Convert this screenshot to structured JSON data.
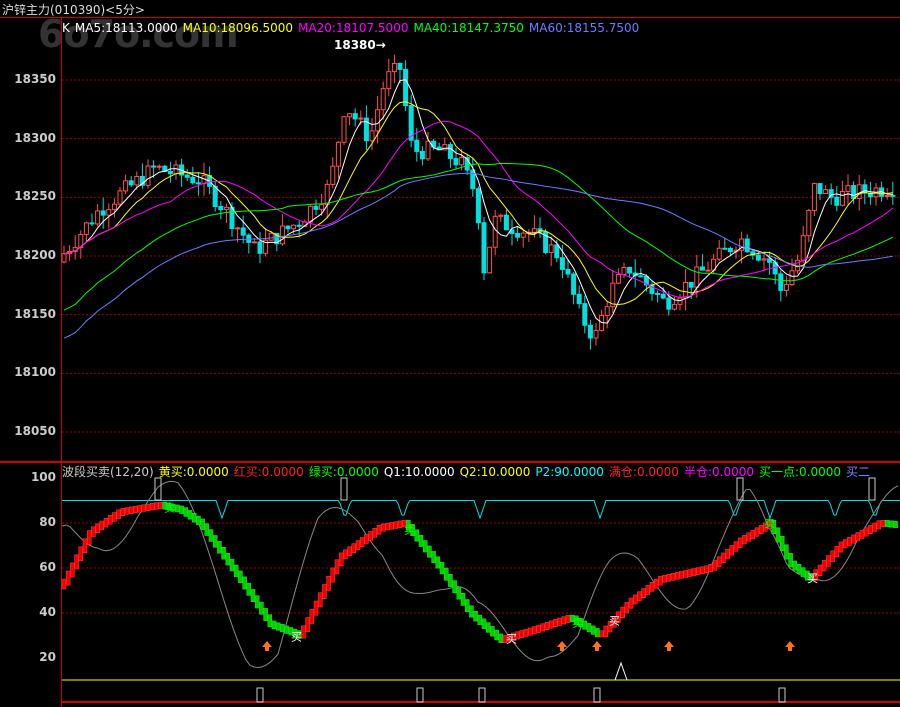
{
  "title": "沪锌主力(010390)<5分>",
  "watermark": "6o7o.com",
  "legend": [
    {
      "text": "K",
      "color": "#ffffff"
    },
    {
      "text": "MA5:18113.0000",
      "color": "#ffffff"
    },
    {
      "text": "MA10:18096.5000",
      "color": "#ffff00"
    },
    {
      "text": "MA20:18107.5000",
      "color": "#ff00ff"
    },
    {
      "text": "MA40:18147.3750",
      "color": "#00ff00"
    },
    {
      "text": "MA60:18155.7500",
      "color": "#6e7cff"
    }
  ],
  "high_marker": "18380→",
  "price_ticks": [
    "18350",
    "18300",
    "18250",
    "18200",
    "18150",
    "18100",
    "18050"
  ],
  "indicator_legend": [
    {
      "text": "波段买卖(12,20)",
      "color": "#cccccc"
    },
    {
      "text": "黄买:0.0000",
      "color": "#ffff00"
    },
    {
      "text": "红买:0.0000",
      "color": "#ff2020"
    },
    {
      "text": "绿买:0.0000",
      "color": "#00ff00"
    },
    {
      "text": "Q1:10.0000",
      "color": "#ffffff"
    },
    {
      "text": "Q2:10.0000",
      "color": "#ffff00"
    },
    {
      "text": "P2:90.0000",
      "color": "#00ffff"
    },
    {
      "text": "满仓:0.0000",
      "color": "#ff2020"
    },
    {
      "text": "半仓:0.0000",
      "color": "#ff00ff"
    },
    {
      "text": "买一点:0.0000",
      "color": "#00ff00"
    },
    {
      "text": "买二",
      "color": "#8080ff"
    }
  ],
  "indicator_ticks": [
    "100",
    "80",
    "60",
    "40",
    "20"
  ],
  "sell_label": "卖",
  "buy_label": "买",
  "price_anchors": [
    [
      62,
      18200
    ],
    [
      100,
      18240
    ],
    [
      155,
      18275
    ],
    [
      200,
      18265
    ],
    [
      220,
      18245
    ],
    [
      255,
      18205
    ],
    [
      300,
      18230
    ],
    [
      330,
      18260
    ],
    [
      345,
      18330
    ],
    [
      370,
      18300
    ],
    [
      385,
      18350
    ],
    [
      400,
      18360
    ],
    [
      412,
      18290
    ],
    [
      440,
      18290
    ],
    [
      460,
      18280
    ],
    [
      478,
      18250
    ],
    [
      480,
      18175
    ],
    [
      495,
      18230
    ],
    [
      530,
      18220
    ],
    [
      560,
      18200
    ],
    [
      580,
      18150
    ],
    [
      595,
      18130
    ],
    [
      610,
      18170
    ],
    [
      630,
      18190
    ],
    [
      665,
      18160
    ],
    [
      700,
      18185
    ],
    [
      740,
      18215
    ],
    [
      770,
      18195
    ],
    [
      780,
      18170
    ],
    [
      800,
      18200
    ],
    [
      815,
      18260
    ],
    [
      830,
      18250
    ],
    [
      900,
      18260
    ]
  ],
  "wave_anchors": [
    [
      62,
      52
    ],
    [
      90,
      76
    ],
    [
      120,
      85
    ],
    [
      160,
      88
    ],
    [
      180,
      86
    ],
    [
      200,
      80
    ],
    [
      240,
      55
    ],
    [
      270,
      35
    ],
    [
      300,
      30
    ],
    [
      340,
      65
    ],
    [
      380,
      78
    ],
    [
      405,
      80
    ],
    [
      440,
      60
    ],
    [
      470,
      40
    ],
    [
      500,
      28
    ],
    [
      530,
      32
    ],
    [
      570,
      38
    ],
    [
      600,
      30
    ],
    [
      630,
      45
    ],
    [
      660,
      55
    ],
    [
      710,
      60
    ],
    [
      740,
      72
    ],
    [
      770,
      80
    ],
    [
      790,
      62
    ],
    [
      810,
      55
    ],
    [
      840,
      70
    ],
    [
      880,
      80
    ],
    [
      900,
      79
    ]
  ],
  "sell_points": [
    170,
    410,
    578,
    770
  ],
  "buy_points": [
    297,
    512,
    615,
    813
  ],
  "arrows": [
    267,
    562,
    597,
    669,
    790
  ],
  "cyan_dips": [
    222,
    345,
    403,
    480,
    600,
    735,
    770,
    835,
    875
  ]
}
